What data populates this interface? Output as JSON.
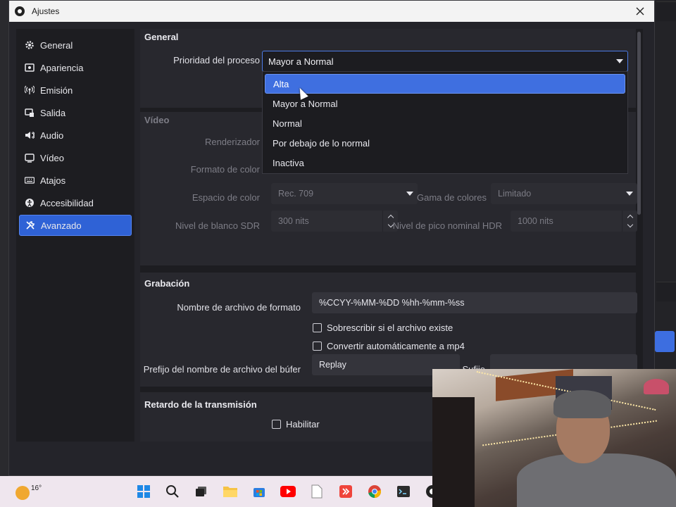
{
  "window": {
    "title": "Ajustes"
  },
  "sidebar": {
    "items": [
      {
        "label": "General",
        "icon": "gear-icon"
      },
      {
        "label": "Apariencia",
        "icon": "palette-icon"
      },
      {
        "label": "Emisión",
        "icon": "broadcast-icon"
      },
      {
        "label": "Salida",
        "icon": "output-icon"
      },
      {
        "label": "Audio",
        "icon": "speaker-icon"
      },
      {
        "label": "Vídeo",
        "icon": "monitor-icon"
      },
      {
        "label": "Atajos",
        "icon": "keyboard-icon"
      },
      {
        "label": "Accesibilidad",
        "icon": "accessibility-icon"
      },
      {
        "label": "Avanzado",
        "icon": "wrench-icon",
        "active": true
      }
    ]
  },
  "general": {
    "title": "General",
    "priority_label": "Prioridad del proceso",
    "priority_value": "Mayor a Normal",
    "priority_options": [
      "Alta",
      "Mayor a Normal",
      "Normal",
      "Por debajo de lo normal",
      "Inactiva"
    ],
    "highlighted_option": "Alta"
  },
  "video": {
    "title": "Vídeo",
    "renderer_label": "Renderizador",
    "color_format_label": "Formato de color",
    "color_space_label": "Espacio de color",
    "color_space_value": "Rec. 709",
    "color_range_label": "Gama de colores",
    "color_range_value": "Limitado",
    "sdr_label": "Nivel de blanco SDR",
    "sdr_value": "300 nits",
    "hdr_label": "Nivel de pico nominal HDR",
    "hdr_value": "1000 nits"
  },
  "recording": {
    "title": "Grabación",
    "filename_label": "Nombre de archivo de formato",
    "filename_value": "%CCYY-%MM-%DD %hh-%mm-%ss",
    "overwrite_label": "Sobrescribir si el archivo existe",
    "remux_label": "Convertir automáticamente a mp4",
    "buffer_prefix_label": "Prefijo del nombre de archivo del búfer",
    "buffer_prefix_value": "Replay",
    "suffix_label": "Sufijo"
  },
  "delay": {
    "title": "Retardo de la transmisión",
    "enable_label": "Habilitar"
  },
  "taskbar": {
    "temperature": "16°",
    "icons": [
      "windows-start-icon",
      "search-icon",
      "task-view-icon",
      "file-explorer-icon",
      "store-icon",
      "youtube-icon",
      "document-icon",
      "anydesk-icon",
      "chrome-icon",
      "terminal-icon",
      "obs-icon"
    ]
  },
  "colors": {
    "accent": "#2f62d6",
    "selection": "#3f6fe0",
    "window_bg": "#24242a",
    "panel_bg": "#1d1d21",
    "section_bg": "#28282e"
  }
}
